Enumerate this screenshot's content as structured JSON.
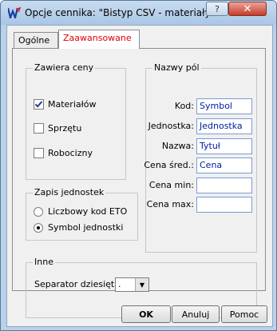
{
  "window": {
    "title": "Opcje cennika: \"Bistyp CSV - materiały\"",
    "help_label": "?",
    "close_label": "✕"
  },
  "tabs": [
    {
      "label": "Ogólne"
    },
    {
      "label": "Zaawansowane"
    }
  ],
  "zawiera_ceny": {
    "label": "Zawiera ceny",
    "items": [
      {
        "label": "Materiałów",
        "checked": true
      },
      {
        "label": "Sprzętu",
        "checked": false
      },
      {
        "label": "Robocizny",
        "checked": false
      }
    ]
  },
  "zapis_jednostek": {
    "label": "Zapis jednostek",
    "options": [
      {
        "label": "Liczbowy kod ETO",
        "selected": false
      },
      {
        "label": "Symbol jednostki",
        "selected": true
      }
    ]
  },
  "nazwy_pol": {
    "label": "Nazwy pól",
    "fields": [
      {
        "label": "Kod:",
        "value": "Symbol"
      },
      {
        "label": "Jednostka:",
        "value": "Jednostka"
      },
      {
        "label": "Nazwa:",
        "value": "Tytuł"
      },
      {
        "label": "Cena śred.:",
        "value": "Cena"
      },
      {
        "label": "Cena min:",
        "value": ""
      },
      {
        "label": "Cena max:",
        "value": ""
      }
    ]
  },
  "inne": {
    "label": "Inne",
    "separator_label": "Separator dziesiętny:",
    "separator_value": "."
  },
  "buttons": {
    "ok": "OK",
    "cancel": "Anuluj",
    "help": "Pomoc"
  }
}
